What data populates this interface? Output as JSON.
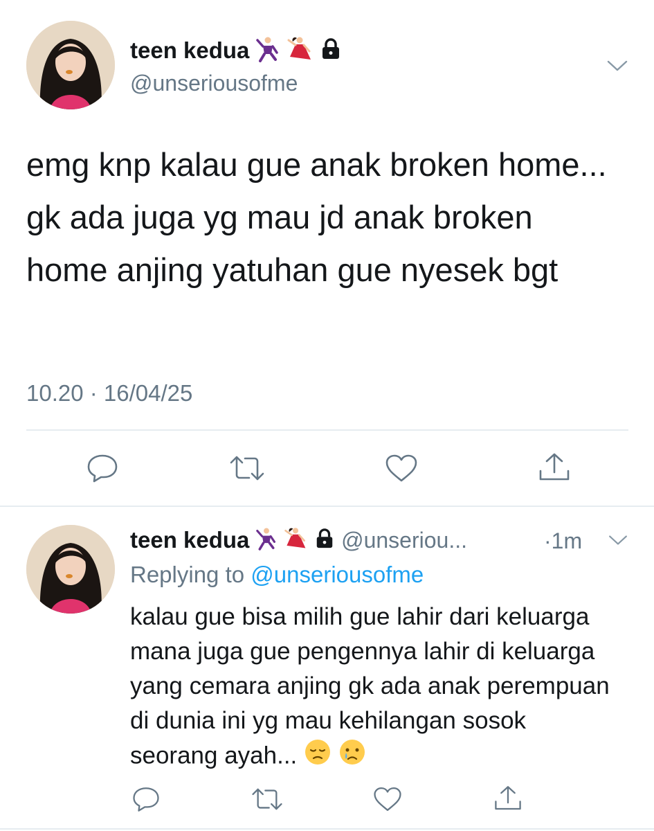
{
  "main_tweet": {
    "display_name": "teen kedua",
    "handle": "@unseriousofme",
    "text": "emg knp kalau gue anak broken home... gk ada juga yg mau jd anak broken home anjing yatuhan gue nyesek bgt",
    "timestamp": "10.20 · 16/04/25",
    "name_emojis": [
      "man-dancing-icon",
      "woman-dancing-icon",
      "lock-icon"
    ],
    "actions": [
      "reply-icon",
      "retweet-icon",
      "like-icon",
      "share-icon"
    ]
  },
  "reply_tweet": {
    "display_name": "teen kedua",
    "handle": "@unseriou...",
    "time_ago": "·1m",
    "replying_to_label": "Replying to",
    "replying_to_handle": "@unseriousofme",
    "text": "kalau gue bisa milih gue lahir dari keluarga mana juga gue pengennya lahir di keluarga yang cemara anjing gk ada anak perempuan di dunia ini yg mau kehilangan sosok seorang ayah...",
    "trailing_emojis": [
      "pensive-face-icon",
      "crying-face-icon"
    ],
    "actions": [
      "reply-icon",
      "retweet-icon",
      "like-icon",
      "share-icon"
    ]
  },
  "colors": {
    "text": "#14171a",
    "secondary": "#657786",
    "link": "#1da1f2",
    "divider": "#e6ecf0"
  }
}
